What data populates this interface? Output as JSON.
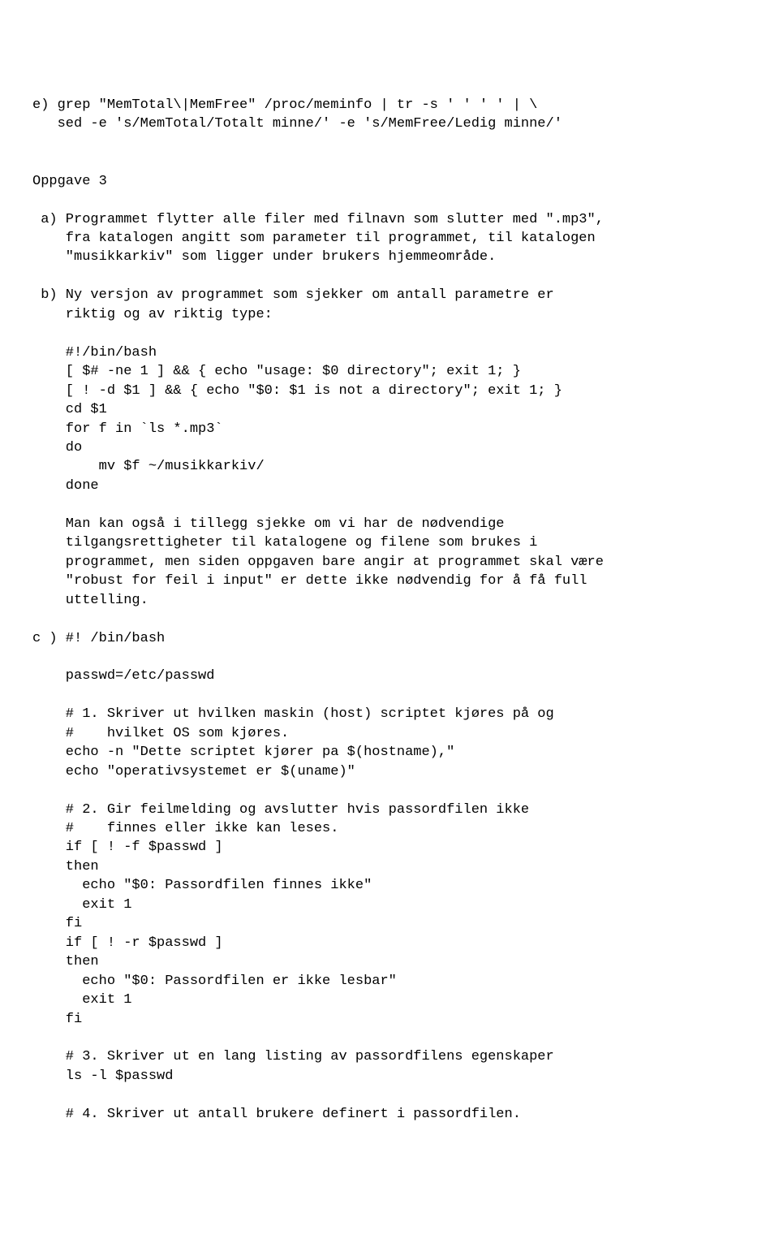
{
  "lines": [
    "e) grep \"MemTotal\\|MemFree\" /proc/meminfo | tr -s ' ' ' ' | \\",
    "   sed -e 's/MemTotal/Totalt minne/' -e 's/MemFree/Ledig minne/'",
    "",
    "",
    "Oppgave 3",
    "",
    " a) Programmet flytter alle filer med filnavn som slutter med \".mp3\",",
    "    fra katalogen angitt som parameter til programmet, til katalogen",
    "    \"musikkarkiv\" som ligger under brukers hjemmeområde.",
    "",
    " b) Ny versjon av programmet som sjekker om antall parametre er",
    "    riktig og av riktig type:",
    "",
    "    #!/bin/bash",
    "    [ $# -ne 1 ] && { echo \"usage: $0 directory\"; exit 1; }",
    "    [ ! -d $1 ] && { echo \"$0: $1 is not a directory\"; exit 1; }",
    "    cd $1",
    "    for f in `ls *.mp3`",
    "    do",
    "        mv $f ~/musikkarkiv/",
    "    done",
    "",
    "    Man kan også i tillegg sjekke om vi har de nødvendige",
    "    tilgangsrettigheter til katalogene og filene som brukes i",
    "    programmet, men siden oppgaven bare angir at programmet skal være",
    "    \"robust for feil i input\" er dette ikke nødvendig for å få full",
    "    uttelling.",
    "",
    "c ) #! /bin/bash",
    "",
    "    passwd=/etc/passwd",
    "",
    "    # 1. Skriver ut hvilken maskin (host) scriptet kjøres på og",
    "    #    hvilket OS som kjøres.",
    "    echo -n \"Dette scriptet kjører pa $(hostname),\"",
    "    echo \"operativsystemet er $(uname)\"",
    "",
    "    # 2. Gir feilmelding og avslutter hvis passordfilen ikke",
    "    #    finnes eller ikke kan leses.",
    "    if [ ! -f $passwd ]",
    "    then",
    "      echo \"$0: Passordfilen finnes ikke\"",
    "      exit 1",
    "    fi",
    "    if [ ! -r $passwd ]",
    "    then",
    "      echo \"$0: Passordfilen er ikke lesbar\"",
    "      exit 1",
    "    fi",
    "",
    "    # 3. Skriver ut en lang listing av passordfilens egenskaper",
    "    ls -l $passwd",
    "",
    "    # 4. Skriver ut antall brukere definert i passordfilen."
  ]
}
